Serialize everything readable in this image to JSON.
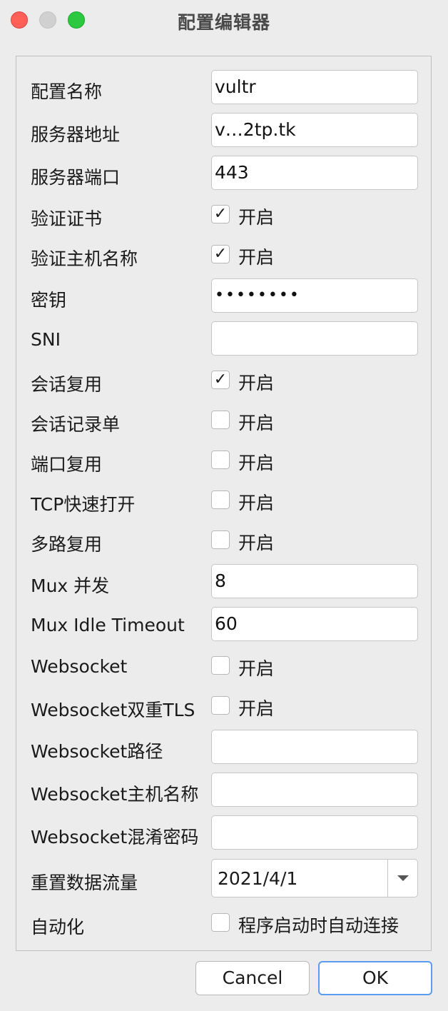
{
  "window": {
    "title": "配置编辑器"
  },
  "on_label": "开启",
  "fields": {
    "profile_name": {
      "label": "配置名称",
      "value": "vultr"
    },
    "server_address": {
      "label": "服务器地址",
      "value": "v…2tp.tk"
    },
    "server_port": {
      "label": "服务器端口",
      "value": "443"
    },
    "verify_cert": {
      "label": "验证证书",
      "checked": true
    },
    "verify_hostname": {
      "label": "验证主机名称",
      "checked": true
    },
    "password": {
      "label": "密钥",
      "value": "••••••••"
    },
    "sni": {
      "label": "SNI",
      "value": ""
    },
    "session_reuse": {
      "label": "会话复用",
      "checked": true
    },
    "session_ticket": {
      "label": "会话记录单",
      "checked": false
    },
    "port_reuse": {
      "label": "端口复用",
      "checked": false
    },
    "tcp_fast_open": {
      "label": "TCP快速打开",
      "checked": false
    },
    "mux": {
      "label": "多路复用",
      "checked": false
    },
    "mux_concurrency": {
      "label": "Mux 并发",
      "value": "8"
    },
    "mux_idle_timeout": {
      "label": "Mux Idle Timeout",
      "value": "60"
    },
    "websocket": {
      "label": "Websocket",
      "checked": false
    },
    "websocket_double_tls": {
      "label": "Websocket双重TLS",
      "checked": false
    },
    "websocket_path": {
      "label": "Websocket路径",
      "value": ""
    },
    "websocket_hostname": {
      "label": "Websocket主机名称",
      "value": ""
    },
    "websocket_obfs_password": {
      "label": "Websocket混淆密码",
      "value": ""
    },
    "reset_traffic": {
      "label": "重置数据流量",
      "value": "2021/4/1"
    },
    "automation": {
      "label": "自动化",
      "checked": false,
      "option_label": "程序启动时自动连接"
    }
  },
  "buttons": {
    "cancel": "Cancel",
    "ok": "OK"
  },
  "colors": {
    "close": "#fe5f57",
    "minimize": "#d0d0d0",
    "maximize": "#2ac940",
    "ok_border": "#5b9bf0"
  }
}
